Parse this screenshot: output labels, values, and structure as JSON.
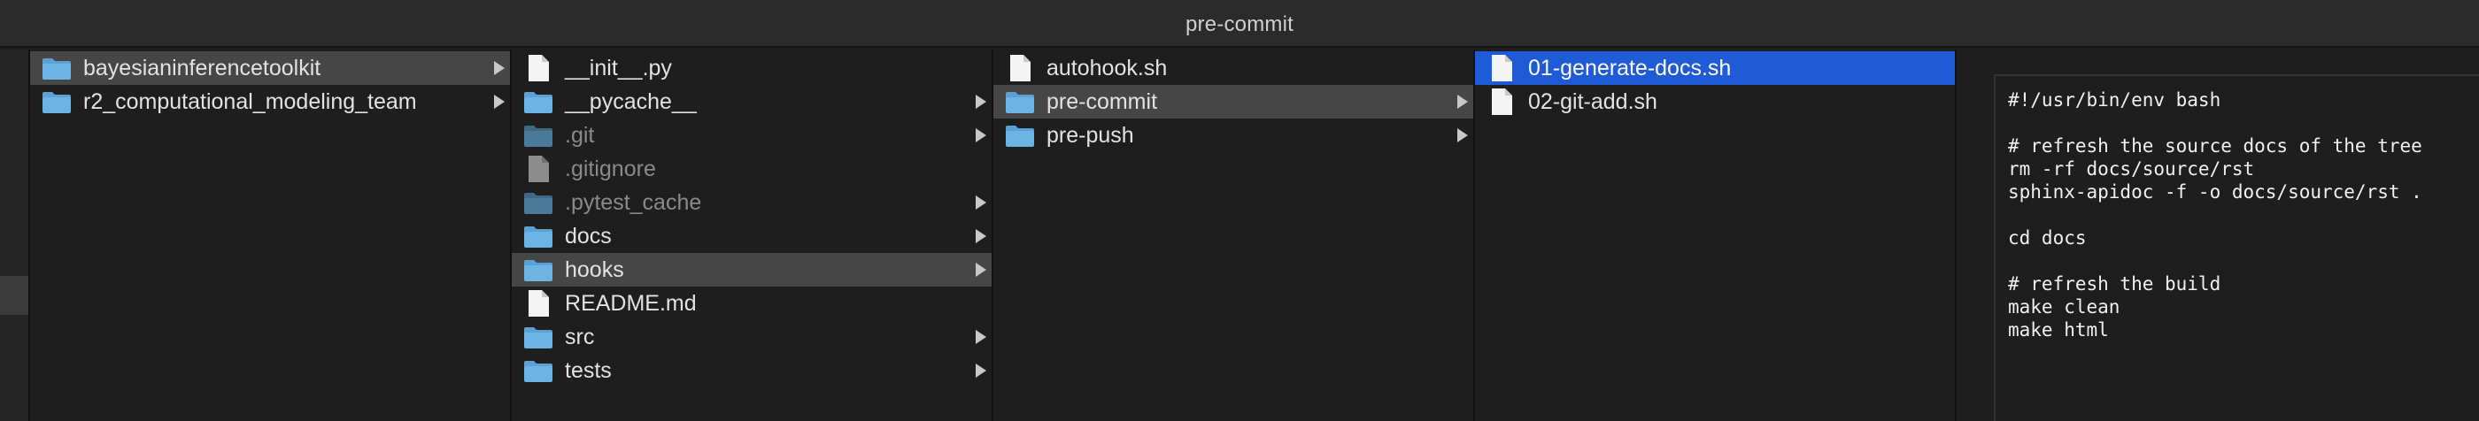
{
  "window": {
    "title": "pre-commit"
  },
  "columns": [
    {
      "items": [
        {
          "label": "bayesianinferencetoolkit",
          "kind": "folder",
          "has_children": true,
          "state": "selected-inactive"
        },
        {
          "label": "r2_computational_modeling_team",
          "kind": "folder",
          "has_children": true,
          "state": "normal"
        }
      ]
    },
    {
      "items": [
        {
          "label": "__init__.py",
          "kind": "file",
          "has_children": false,
          "state": "normal"
        },
        {
          "label": "__pycache__",
          "kind": "folder",
          "has_children": true,
          "state": "normal"
        },
        {
          "label": ".git",
          "kind": "folder",
          "has_children": true,
          "state": "dim"
        },
        {
          "label": ".gitignore",
          "kind": "file",
          "has_children": false,
          "state": "dim"
        },
        {
          "label": ".pytest_cache",
          "kind": "folder",
          "has_children": true,
          "state": "dim"
        },
        {
          "label": "docs",
          "kind": "folder",
          "has_children": true,
          "state": "normal"
        },
        {
          "label": "hooks",
          "kind": "folder",
          "has_children": true,
          "state": "selected-inactive"
        },
        {
          "label": "README.md",
          "kind": "file",
          "has_children": false,
          "state": "normal"
        },
        {
          "label": "src",
          "kind": "folder",
          "has_children": true,
          "state": "normal"
        },
        {
          "label": "tests",
          "kind": "folder",
          "has_children": true,
          "state": "normal"
        }
      ]
    },
    {
      "items": [
        {
          "label": "autohook.sh",
          "kind": "file",
          "has_children": false,
          "state": "normal"
        },
        {
          "label": "pre-commit",
          "kind": "folder",
          "has_children": true,
          "state": "selected-inactive"
        },
        {
          "label": "pre-push",
          "kind": "folder",
          "has_children": true,
          "state": "normal"
        }
      ]
    },
    {
      "items": [
        {
          "label": "01-generate-docs.sh",
          "kind": "file",
          "has_children": false,
          "state": "selected-active"
        },
        {
          "label": "02-git-add.sh",
          "kind": "file",
          "has_children": false,
          "state": "normal"
        }
      ]
    }
  ],
  "preview": {
    "lines": [
      "#!/usr/bin/env bash",
      "",
      "# refresh the source docs of the tree",
      "rm -rf docs/source/rst",
      "sphinx-apidoc -f -o docs/source/rst .",
      "",
      "cd docs",
      "",
      "# refresh the build",
      "make clean",
      "make html"
    ]
  },
  "colors": {
    "selection_active": "#1f5bd6",
    "selection_inactive": "#464646",
    "folder": "#6cb4e4",
    "background": "#1e1e1e"
  },
  "icons": {
    "folder": "folder-icon",
    "file": "document-icon",
    "disclosure": "chevron-right-icon"
  }
}
